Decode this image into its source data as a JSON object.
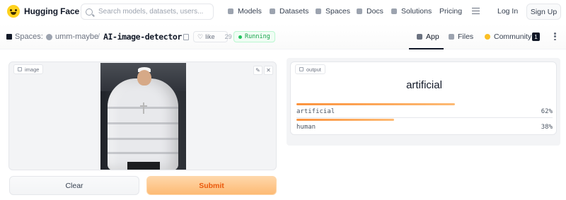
{
  "nav": {
    "brand": "Hugging Face",
    "search_placeholder": "Search models, datasets, users...",
    "links": [
      "Models",
      "Datasets",
      "Spaces",
      "Docs",
      "Solutions",
      "Pricing"
    ],
    "login": "Log In",
    "signup": "Sign Up"
  },
  "space": {
    "section": "Spaces:",
    "owner": "umm-maybe",
    "separator": "/",
    "name": "AI-image-detector",
    "like_label": "like",
    "like_count": "29",
    "status": "Running",
    "tabs": [
      "App",
      "Files",
      "Community"
    ],
    "community_count": "1"
  },
  "app": {
    "input_label": "image",
    "output_label": "output",
    "clear_label": "Clear",
    "submit_label": "Submit",
    "top_prediction": "artificial",
    "confidences": [
      {
        "label": "artificial",
        "value": "62%",
        "fraction": 0.62
      },
      {
        "label": "human",
        "value": "38%",
        "fraction": 0.38
      }
    ]
  },
  "colors": {
    "accent": "#fb923c",
    "status_green": "#22c55e",
    "brand_yellow": "#ffd21e"
  }
}
